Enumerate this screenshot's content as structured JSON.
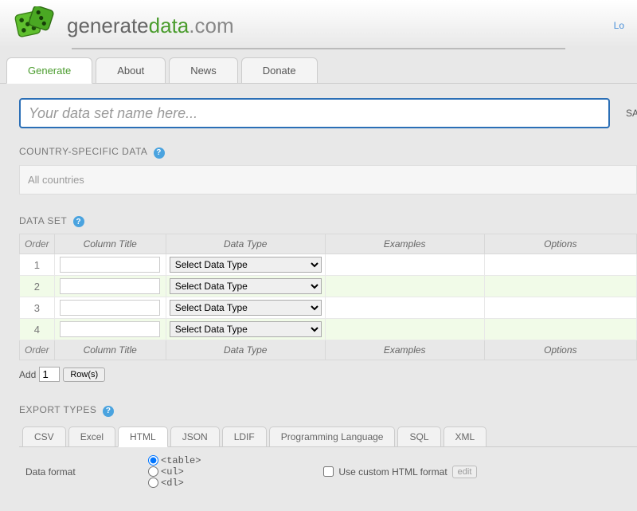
{
  "brand": {
    "generate": "generate",
    "data": "data",
    "dotcom": ".com"
  },
  "login_link": "Lo",
  "nav": {
    "tabs": [
      "Generate",
      "About",
      "News",
      "Donate"
    ],
    "active": 0
  },
  "name_input": {
    "placeholder": "Your data set name here...",
    "value": ""
  },
  "save_button": "SA",
  "sections": {
    "country": {
      "title": "COUNTRY-SPECIFIC DATA",
      "value": "All countries"
    },
    "dataset": {
      "title": "DATA SET"
    },
    "export": {
      "title": "EXPORT TYPES"
    }
  },
  "grid": {
    "headers": {
      "order": "Order",
      "column_title": "Column Title",
      "data_type": "Data Type",
      "examples": "Examples",
      "options": "Options"
    },
    "select_placeholder": "Select Data Type",
    "rows": [
      {
        "n": "1"
      },
      {
        "n": "2"
      },
      {
        "n": "3"
      },
      {
        "n": "4"
      }
    ]
  },
  "addrow": {
    "label": "Add",
    "count": "1",
    "button": "Row(s)"
  },
  "export": {
    "tabs": [
      "CSV",
      "Excel",
      "HTML",
      "JSON",
      "LDIF",
      "Programming Language",
      "SQL",
      "XML"
    ],
    "active": 2,
    "format_label": "Data format",
    "formats": [
      "<table>",
      "<ul>",
      "<dl>"
    ],
    "format_selected": 0,
    "custom": {
      "label": "Use custom HTML format",
      "edit": "edit",
      "checked": false
    }
  }
}
